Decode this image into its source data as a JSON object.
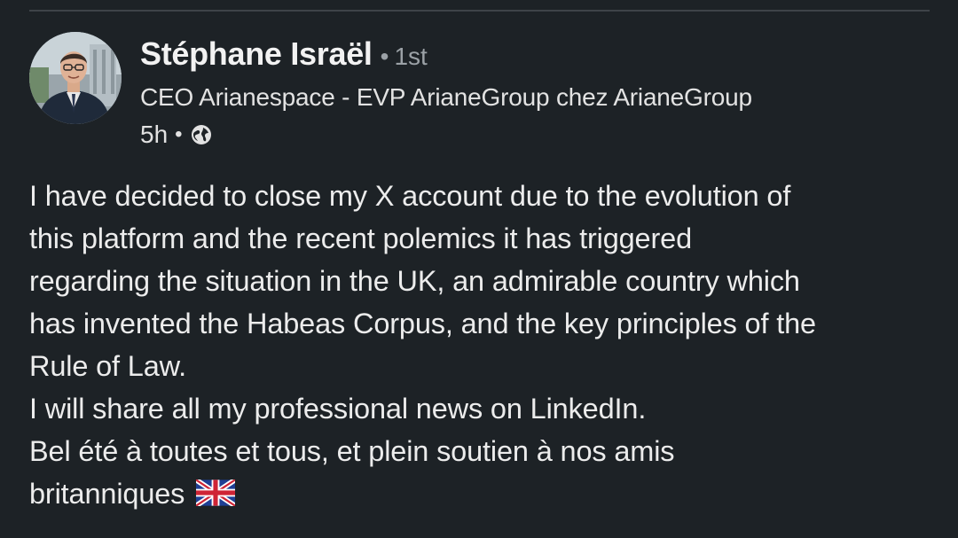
{
  "author": {
    "name": "Stéphane Israël",
    "separator": "•",
    "connection_degree": "1st",
    "headline": "CEO Arianespace - EVP ArianeGroup chez ArianeGroup",
    "timestamp": "5h",
    "time_separator": "•",
    "visibility_icon": "globe-icon",
    "avatar_icon": "profile-photo"
  },
  "post": {
    "lines": [
      "I have decided to close my X account due to the evolution of",
      "this platform and the recent polemics it has triggered",
      "regarding the situation in the UK, an admirable country which",
      "has invented the Habeas Corpus, and the key principles of the",
      "Rule of Law.",
      "I will share all my professional news on LinkedIn.",
      "Bel été à toutes et tous, et plein soutien à nos amis",
      "britanniques"
    ],
    "emoji": "uk-flag-icon"
  },
  "colors": {
    "background": "#1d2226",
    "text_primary": "#ececec",
    "text_secondary": "#9ba1a6",
    "divider": "#3e4348"
  }
}
